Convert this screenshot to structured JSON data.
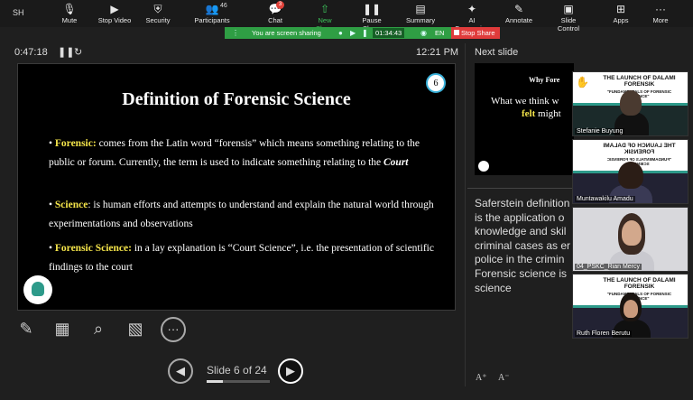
{
  "toolbar": {
    "left_label": "SH",
    "items": [
      {
        "label": "Mute",
        "icon": "microphone-icon"
      },
      {
        "label": "Stop Video",
        "icon": "video-camera-icon"
      },
      {
        "label": "Security",
        "icon": "shield-icon"
      },
      {
        "label": "Participants",
        "icon": "people-icon",
        "count": "46"
      },
      {
        "label": "Chat",
        "icon": "chat-icon",
        "badge": "3"
      },
      {
        "label": "New Share",
        "icon": "share-arrow-icon"
      },
      {
        "label": "Pause Share",
        "icon": "pause-icon"
      },
      {
        "label": "Summary",
        "icon": "summary-icon"
      },
      {
        "label": "AI Companion",
        "icon": "sparkle-icon"
      },
      {
        "label": "Annotate",
        "icon": "pen-icon"
      },
      {
        "label": "Slide Control",
        "icon": "slide-control-icon"
      },
      {
        "label": "Apps",
        "icon": "apps-icon"
      },
      {
        "label": "More",
        "icon": "more-dots-icon"
      }
    ]
  },
  "share_bar": {
    "message": "You are screen sharing",
    "timer": "01:34:43",
    "lang": "EN",
    "stop_label": "Stop Share"
  },
  "presenter": {
    "elapsed": "0:47:18",
    "clock": "12:21 PM",
    "next_slide_label": "Next slide",
    "slide_counter": "Slide 6 of 24",
    "progress": 0.25
  },
  "slide": {
    "title": "Definition of Forensic Science",
    "number": "6",
    "p1_kw": "Forensic:",
    "p1_a": " comes from the Latin word “forensis” which means something relating to the public or forum. Currently, the term is used to indicate something relating to the ",
    "p1_court": "Court",
    "p2_kw": "Science",
    "p2_text": ": is human efforts and attempts to understand and explain the natural world through experimentations and observations",
    "p3_kw": "Forensic Science:",
    "p3_text": " in a lay explanation is “Court Science”, i.e. the presentation of scientific findings to the court"
  },
  "next_slide": {
    "title": "Why Fore",
    "line1": "What we think w",
    "line2_kw": "felt",
    "line2_rest": " might"
  },
  "notes": {
    "lines": [
      "Saferstein definition",
      "is the application o",
      "knowledge and skil",
      "criminal cases as er",
      "police in the crimin",
      "Forensic science is",
      "science"
    ]
  },
  "participants": [
    {
      "name": "Stefanie Buyung",
      "banner_title": "THE LAUNCH OF DALAMI FORENSIK",
      "banner_sub": "\"FUNDAMENTALS OF FORENSIC SCIENCE\"",
      "raised_hand": true
    },
    {
      "name": "Muntawakilu Amadu",
      "banner_title": "THE LAUNCH OF DALAMI FORENSIK",
      "banner_sub": "\"FUNDAMENTALS OF FORENSIC SCIENCE\"",
      "mirrored": true
    },
    {
      "name": "04_PSKC_Rian Mercy"
    },
    {
      "name": "Ruth Floren Berutu",
      "banner_title": "THE LAUNCH OF DALAMI FORENSIK",
      "banner_sub": "\"FUNDAMENTALS OF FORENSIC SCIENCE\""
    }
  ],
  "colors": {
    "share_green": "#2f9e44",
    "stop_red": "#e03b3b",
    "keyword_yellow": "#f4e44a",
    "brand_teal": "#2d9a8a"
  }
}
